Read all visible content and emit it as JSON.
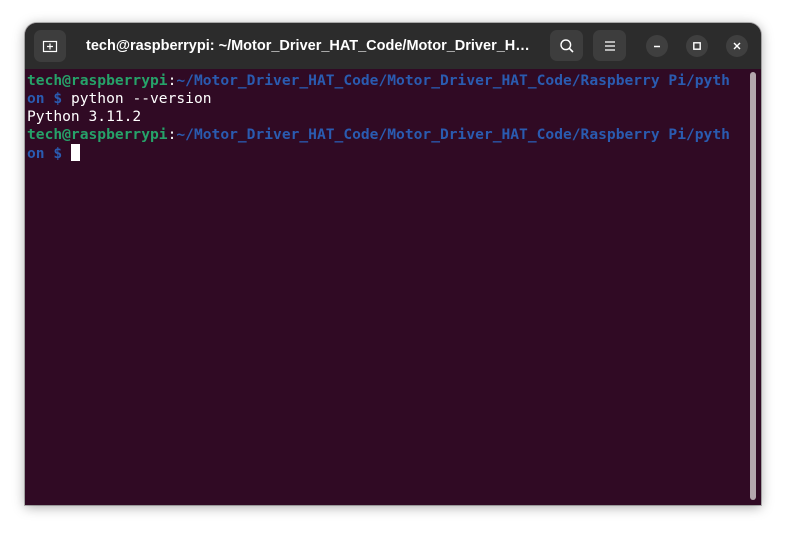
{
  "window": {
    "title": "tech@raspberrypi: ~/Motor_Driver_HAT_Code/Motor_Driver_HAT_Code/Raspberry Pi/python"
  },
  "header": {
    "new_tab_icon": "new-tab-icon",
    "search_icon": "search-icon",
    "menu_icon": "hamburger-menu-icon",
    "minimize_icon": "minimize-icon",
    "maximize_icon": "maximize-icon",
    "close_icon": "close-icon"
  },
  "terminal": {
    "lines": [
      {
        "user": "tech@raspberrypi",
        "colon": ":",
        "path": "~/Motor_Driver_HAT_Code/Motor_Driver_HAT_Code/Raspberry Pi/pyth"
      },
      {
        "path": "on",
        "prompt": " $ ",
        "command": "python --version"
      },
      {
        "text": "Python 3.11.2"
      },
      {
        "user": "tech@raspberrypi",
        "colon": ":",
        "path": "~/Motor_Driver_HAT_Code/Motor_Driver_HAT_Code/Raspberry Pi/pyth"
      },
      {
        "path": "on",
        "prompt": " $ ",
        "command": ""
      }
    ]
  },
  "colors": {
    "background": "#300a24",
    "user": "#26a269",
    "path": "#2a5bb0",
    "text": "#ffffff",
    "titlebar": "#2c2c2c"
  }
}
